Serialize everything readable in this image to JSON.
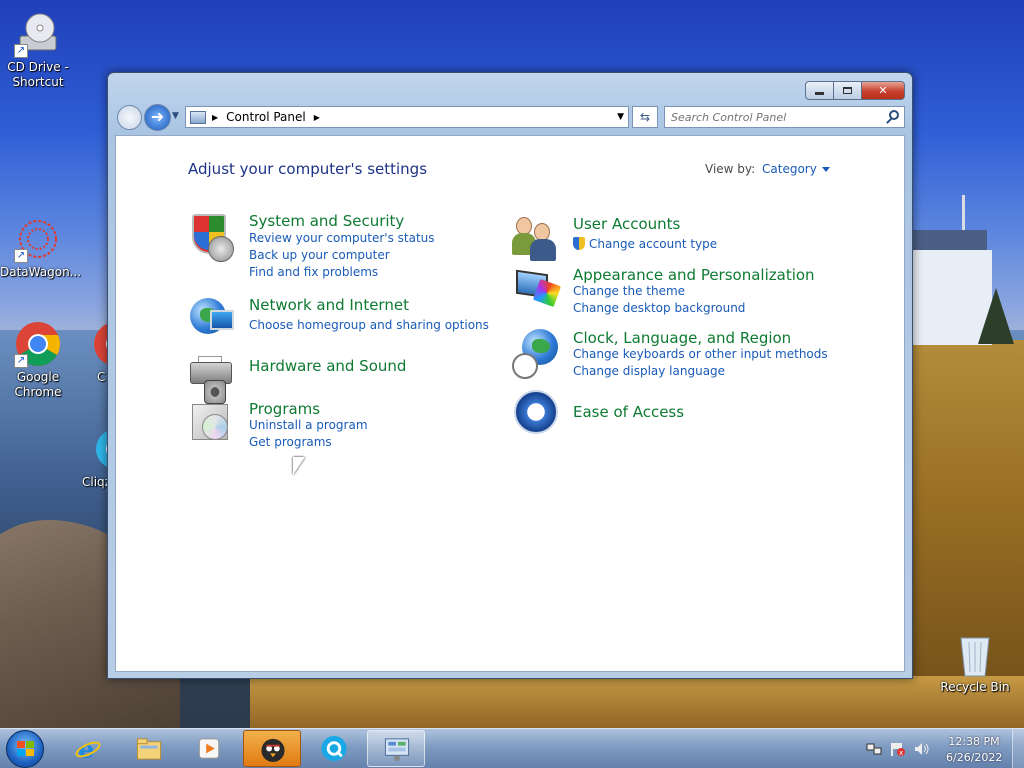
{
  "desktop": {
    "icons": [
      {
        "label": "CD Drive -\nShortcut",
        "icon": "cd-drive-icon"
      },
      {
        "label": "DataWagon...",
        "icon": "datawagon-icon"
      },
      {
        "label": "Google\nChrome",
        "icon": "chrome-icon"
      },
      {
        "label": "C",
        "icon": "chrome-icon"
      },
      {
        "label": "Cliqz",
        "icon": "cliqz-icon"
      },
      {
        "label": "Recycle Bin",
        "icon": "recycle-bin-icon"
      }
    ]
  },
  "window": {
    "address": {
      "breadcrumb": [
        "Control Panel"
      ]
    },
    "search": {
      "placeholder": "Search Control Panel"
    },
    "title": "Adjust your computer's settings",
    "view_by": {
      "label": "View by:",
      "value": "Category"
    },
    "categories_left": [
      {
        "title": "System and Security",
        "icon": "shield-icon",
        "links": [
          "Review your computer's status",
          "Back up your computer",
          "Find and fix problems"
        ]
      },
      {
        "title": "Network and Internet",
        "icon": "network-icon",
        "links": [
          "Choose homegroup and sharing options"
        ]
      },
      {
        "title": "Hardware and Sound",
        "icon": "printer-icon",
        "links": []
      },
      {
        "title": "Programs",
        "icon": "programs-icon",
        "links": [
          "Uninstall a program",
          "Get programs"
        ]
      }
    ],
    "categories_right": [
      {
        "title": "User Accounts",
        "icon": "users-icon",
        "links": [
          "Change account type"
        ]
      },
      {
        "title": "Appearance and Personalization",
        "icon": "appearance-icon",
        "links": [
          "Change the theme",
          "Change desktop background"
        ]
      },
      {
        "title": "Clock, Language, and Region",
        "icon": "clock-globe-icon",
        "links": [
          "Change keyboards or other input methods",
          "Change display language"
        ]
      },
      {
        "title": "Ease of Access",
        "icon": "ease-of-access-icon",
        "links": []
      }
    ]
  },
  "taskbar": {
    "items": [
      {
        "name": "internet-explorer",
        "state": "pinned"
      },
      {
        "name": "file-explorer",
        "state": "pinned"
      },
      {
        "name": "media-player",
        "state": "pinned"
      },
      {
        "name": "bird-app",
        "state": "active"
      },
      {
        "name": "cliqz",
        "state": "pinned"
      },
      {
        "name": "control-panel",
        "state": "open"
      }
    ],
    "clock": {
      "time": "12:38 PM",
      "date": "6/26/2022"
    }
  },
  "colors": {
    "category_title": "#0e7a32",
    "link": "#1a5bb8",
    "heading": "#1e3287",
    "close_button": "#c7402b"
  }
}
